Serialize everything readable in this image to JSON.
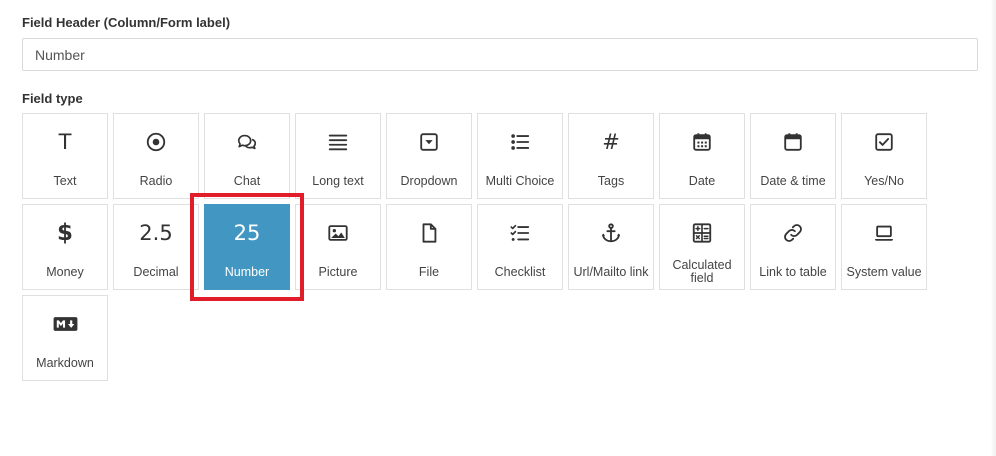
{
  "form": {
    "header_label": "Field Header (Column/Form label)",
    "header_value": "Number",
    "type_label": "Field type"
  },
  "field_types": [
    {
      "label": "Text",
      "icon": "text-icon",
      "glyph": "T"
    },
    {
      "label": "Radio",
      "icon": "radio-icon"
    },
    {
      "label": "Chat",
      "icon": "chat-icon"
    },
    {
      "label": "Long text",
      "icon": "long-text-icon"
    },
    {
      "label": "Dropdown",
      "icon": "dropdown-icon"
    },
    {
      "label": "Multi Choice",
      "icon": "multi-choice-icon"
    },
    {
      "label": "Tags",
      "icon": "hash-icon",
      "glyph": "#"
    },
    {
      "label": "Date",
      "icon": "calendar-icon"
    },
    {
      "label": "Date & time",
      "icon": "calendar-clock-icon"
    },
    {
      "label": "Yes/No",
      "icon": "checkbox-icon"
    },
    {
      "label": "Money",
      "icon": "dollar-icon",
      "glyph": "$"
    },
    {
      "label": "Decimal",
      "icon": "decimal-icon",
      "glyph": "2.5"
    },
    {
      "label": "Number",
      "icon": "number-icon",
      "glyph": "25",
      "selected": true
    },
    {
      "label": "Picture",
      "icon": "image-icon"
    },
    {
      "label": "File",
      "icon": "file-icon"
    },
    {
      "label": "Checklist",
      "icon": "checklist-icon"
    },
    {
      "label": "Url/Mailto link",
      "icon": "anchor-icon"
    },
    {
      "label": "Calculated field",
      "icon": "calculator-icon"
    },
    {
      "label": "Link to table",
      "icon": "link-icon"
    },
    {
      "label": "System value",
      "icon": "laptop-icon"
    },
    {
      "label": "Markdown",
      "icon": "markdown-icon"
    }
  ],
  "colors": {
    "selected": "#4196c2",
    "highlight": "#e11d2a"
  }
}
